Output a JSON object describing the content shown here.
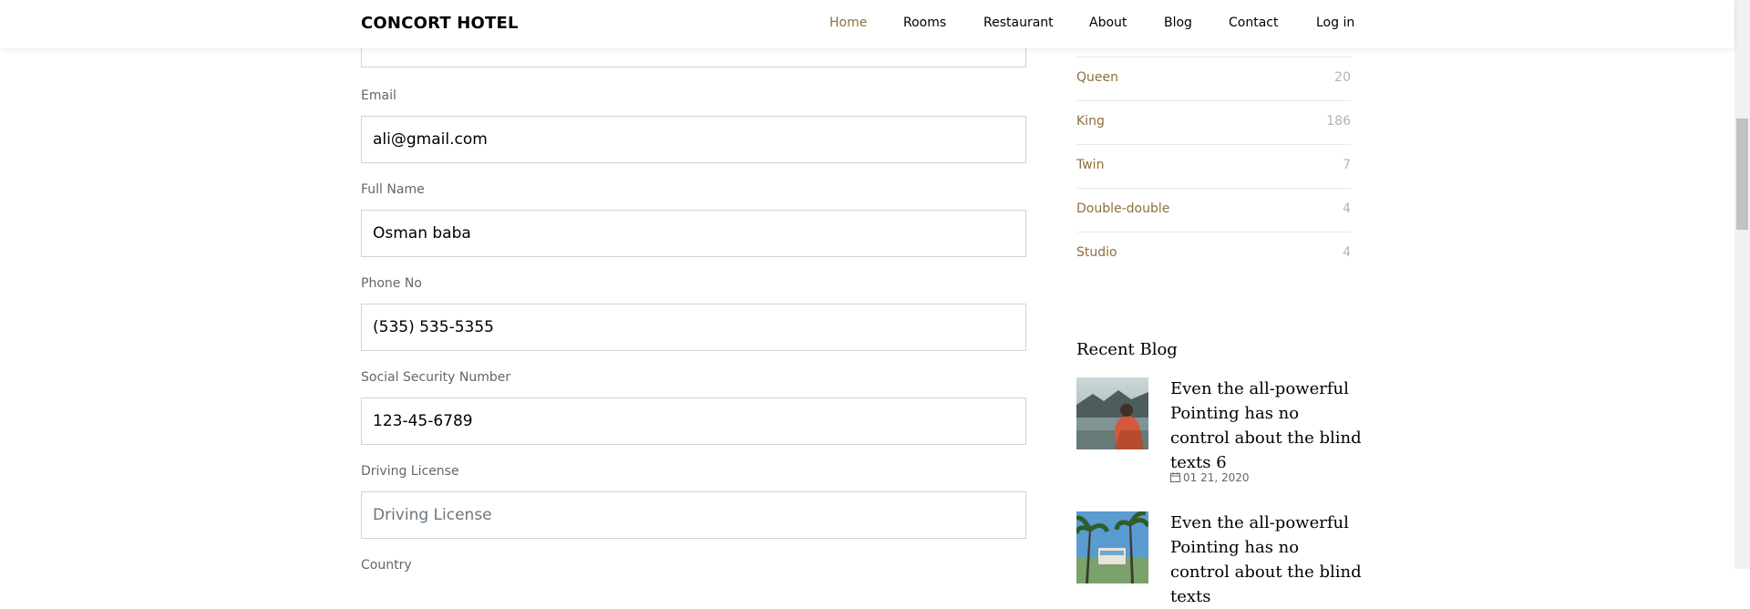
{
  "header": {
    "brand": "CONCORT HOTEL",
    "nav": [
      {
        "label": "Home",
        "active": true
      },
      {
        "label": "Rooms"
      },
      {
        "label": "Restaurant"
      },
      {
        "label": "About"
      },
      {
        "label": "Blog"
      },
      {
        "label": "Contact"
      },
      {
        "label": "Log in"
      }
    ]
  },
  "form": {
    "email": {
      "label": "Email",
      "value": "ali@gmail.com"
    },
    "full_name": {
      "label": "Full Name",
      "value": "Osman baba"
    },
    "phone": {
      "label": "Phone No",
      "value": "(535) 535-5355"
    },
    "ssn": {
      "label": "Social Security Number",
      "value": "123-45-6789"
    },
    "driving_license": {
      "label": "Driving License",
      "value": "",
      "placeholder": "Driving License"
    },
    "country": {
      "label": "Country"
    }
  },
  "sidebar": {
    "categories": [
      {
        "name": "Queen",
        "count": "20"
      },
      {
        "name": "King",
        "count": "186"
      },
      {
        "name": "Twin",
        "count": "7"
      },
      {
        "name": "Double-double",
        "count": "4"
      },
      {
        "name": "Studio",
        "count": "4"
      }
    ],
    "recent_blog": {
      "title": "Recent Blog",
      "posts": [
        {
          "title": "Even the all-powerful Pointing has no control about the blind texts 6",
          "date": "01 21, 2020"
        },
        {
          "title": "Even the all-powerful Pointing has no control about the blind texts"
        }
      ]
    }
  },
  "colors": {
    "accent": "#8d703b",
    "muted": "#b3b3b3",
    "border": "#ced4da"
  }
}
